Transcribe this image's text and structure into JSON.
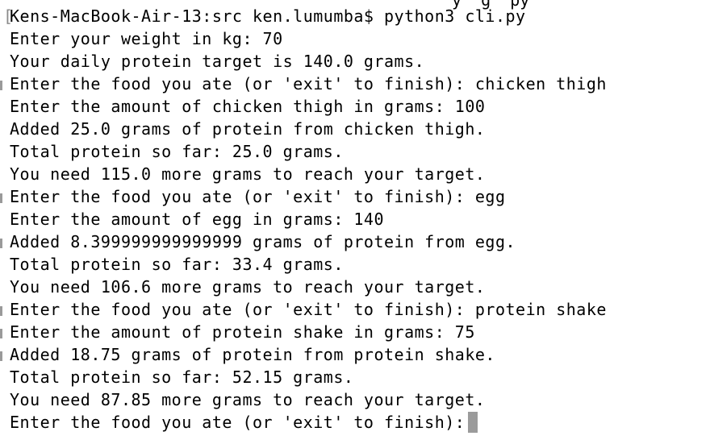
{
  "window": {
    "cutoff_text": "y  g  py"
  },
  "terminal": {
    "bracket": "[",
    "lines": [
      "Kens-MacBook-Air-13:src ken.lumumba$ python3 cli.py",
      "Enter your weight in kg: 70",
      "Your daily protein target is 140.0 grams.",
      "Enter the food you ate (or 'exit' to finish): chicken thigh",
      "Enter the amount of chicken thigh in grams: 100",
      "Added 25.0 grams of protein from chicken thigh.",
      "Total protein so far: 25.0 grams.",
      "You need 115.0 more grams to reach your target.",
      "Enter the food you ate (or 'exit' to finish): egg",
      "Enter the amount of egg in grams: 140",
      "Added 8.399999999999999 grams of protein from egg.",
      "Total protein so far: 33.4 grams.",
      "You need 106.6 more grams to reach your target.",
      "Enter the food you ate (or 'exit' to finish): protein shake",
      "Enter the amount of protein shake in grams: 75",
      "Added 18.75 grams of protein from protein shake.",
      "Total protein so far: 52.15 grams.",
      "You need 87.85 more grams to reach your target."
    ],
    "prompt_line": "Enter the food you ate (or 'exit' to finish):"
  }
}
